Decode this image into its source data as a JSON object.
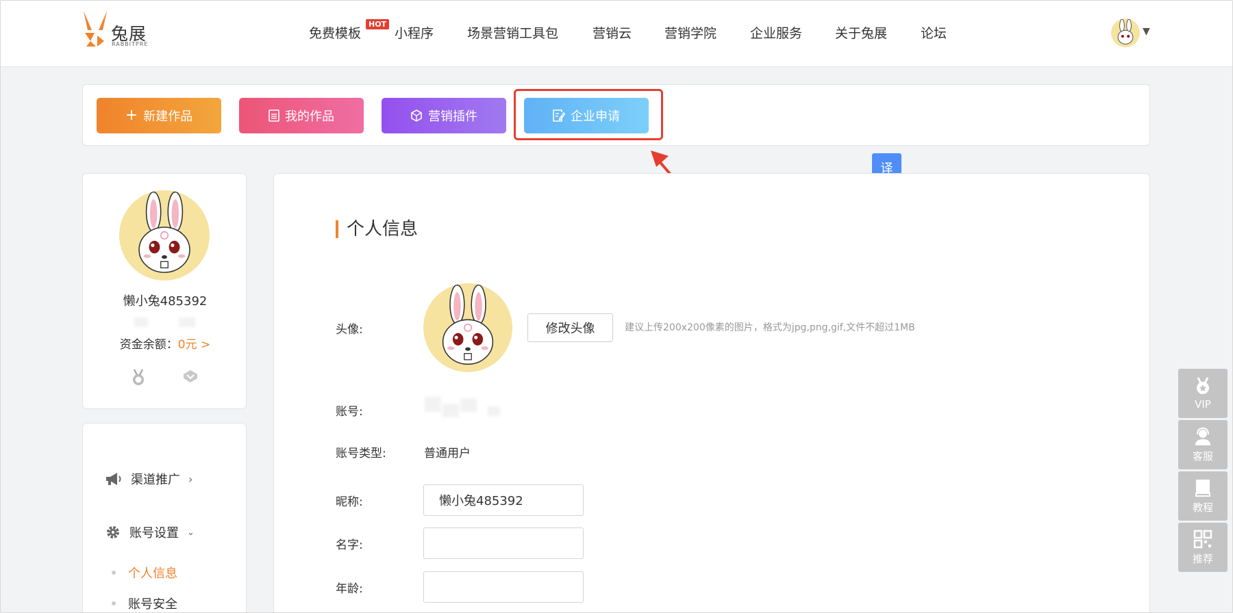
{
  "header": {
    "logo_name": "兔展",
    "logo_sub": "RABBITPRE",
    "hot_badge": "HOT",
    "nav": [
      "免费模板",
      "小程序",
      "场景营销工具包",
      "营销云",
      "营销学院",
      "企业服务",
      "关于兔展",
      "论坛"
    ]
  },
  "actions": {
    "new_work": "新建作品",
    "my_works": "我的作品",
    "plugins": "营销插件",
    "enterprise": "企业申请"
  },
  "translate_badge": "译",
  "profile": {
    "name": "懒小兔485392",
    "balance_label": "资金余额：",
    "balance_value": "0元 >"
  },
  "menu": {
    "channel": "渠道推广",
    "account_settings": "账号设置",
    "personal_info": "个人信息",
    "account_security": "账号安全"
  },
  "main": {
    "title": "个人信息",
    "avatar_label": "头像:",
    "change_avatar": "修改头像",
    "avatar_hint": "建议上传200x200像素的图片，格式为jpg,png,gif,文件不超过1MB",
    "account_label": "账号:",
    "account_type_label": "账号类型:",
    "account_type_value": "普通用户",
    "nickname_label": "昵称:",
    "nickname_value": "懒小兔485392",
    "name_label": "名字:",
    "name_value": "",
    "age_label": "年龄:",
    "age_value": ""
  },
  "side_tools": [
    "VIP",
    "客服",
    "教程",
    "推荐"
  ],
  "colors": {
    "accent": "#f0832b",
    "highlight": "#e53e30",
    "btn_new": "#f0832b",
    "btn_mine": "#ec5577",
    "btn_plugin": "#9450ee",
    "btn_enterprise": "#5fb2f6"
  }
}
